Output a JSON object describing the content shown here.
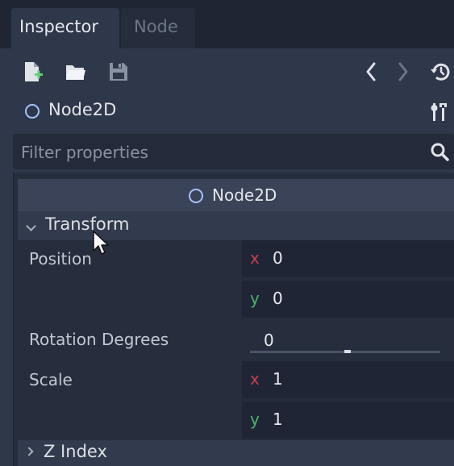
{
  "tabs": [
    {
      "label": "Inspector",
      "active": true
    },
    {
      "label": "Node",
      "active": false
    }
  ],
  "toolbar": {
    "icons": [
      "new-resource-icon",
      "open-folder-icon",
      "save-icon",
      "history-back-icon",
      "history-forward-icon",
      "object-history-icon"
    ]
  },
  "node": {
    "name": "Node2D",
    "tools_icon": "tools-icon"
  },
  "filter": {
    "placeholder": "Filter properties",
    "icon": "search-icon"
  },
  "inspector": {
    "section_title": "Node2D",
    "group": {
      "label": "Transform",
      "expanded": true
    },
    "properties": {
      "position": {
        "label": "Position",
        "x_axis": "x",
        "x": "0",
        "y_axis": "y",
        "y": "0"
      },
      "rotation": {
        "label": "Rotation Degrees",
        "value": "0",
        "slider_fraction": 0.5
      },
      "scale": {
        "label": "Scale",
        "x_axis": "x",
        "x": "1",
        "y_axis": "y",
        "y": "1"
      }
    },
    "collapsed_group": {
      "label": "Z Index",
      "expanded": false
    }
  },
  "colors": {
    "background": "#2f374a",
    "node_icon": "#a6c2ff",
    "axis_x": "#c6404f",
    "axis_y": "#4ab56a"
  }
}
